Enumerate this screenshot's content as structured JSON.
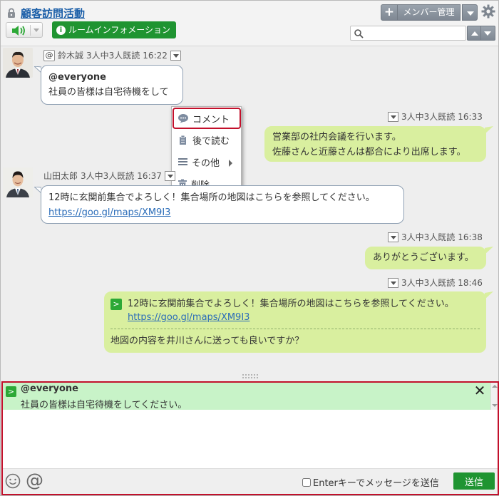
{
  "header": {
    "room_title": "顧客訪問活動",
    "room_info_label": "ルームインフォメーション",
    "add_label": "+",
    "member_label": "メンバー管理",
    "search_placeholder": ""
  },
  "messages": [
    {
      "sender": "鈴木誠",
      "read_status": "3人中3人既読",
      "time": "16:22",
      "mention": "@everyone",
      "text": "社員の皆様は自宅待機をして"
    },
    {
      "read_status": "3人中3人既読",
      "time": "16:33",
      "lines": [
        "営業部の社内会議を行います。",
        "佐藤さんと近藤さんは都合により出席します。"
      ]
    },
    {
      "sender": "山田太郎",
      "read_status": "3人中3人既読",
      "time": "16:37",
      "text": "12時に玄関前集合でよろしく！集合場所の地図はこちらを参照してください。",
      "link": "https://goo.gl/maps/XM9I3"
    },
    {
      "read_status": "3人中3人既読",
      "time": "16:38",
      "text": "ありがとうございます。"
    },
    {
      "read_status": "3人中3人既読",
      "time": "18:46",
      "quote_text": "12時に玄関前集合でよろしく！集合場所の地図はこちらを参照してください。",
      "quote_link": "https://goo.gl/maps/XM9I3",
      "text": "地図の内容を井川さんに送っても良いですか？"
    }
  ],
  "context_menu": {
    "items": [
      "コメント",
      "後で読む",
      "その他",
      "削除"
    ],
    "highlighted": "コメント"
  },
  "composer": {
    "reply_to": "@everyone",
    "reply_text": "社員の皆様は自宅待機をしてください。",
    "input_value": "",
    "enter_send_label": "Enterキーでメッセージを送信",
    "send_label": "送信"
  },
  "colors": {
    "accent_green": "#1f9431",
    "bubble_green": "#d9ef9f",
    "link_blue": "#2a6cb8",
    "highlight_red": "#c2102b"
  }
}
